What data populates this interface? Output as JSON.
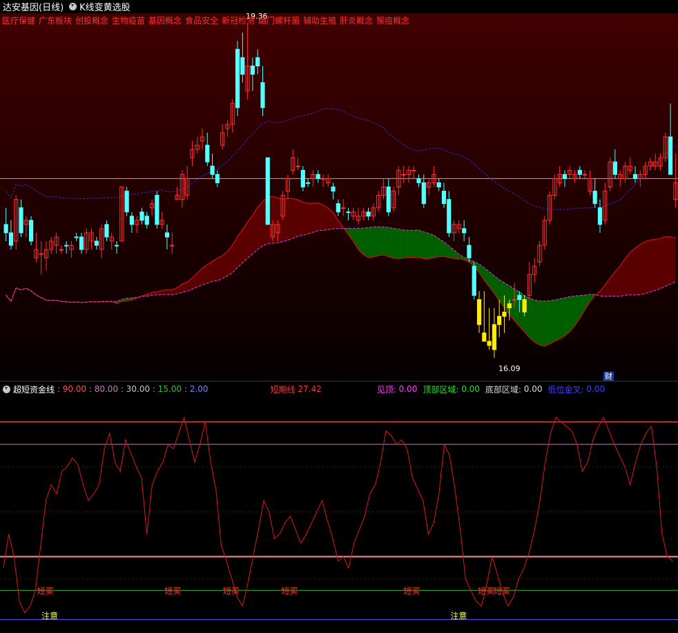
{
  "titlebar": {
    "stock_label": "达安基因(日线)",
    "formula_label": "K线变黄选股"
  },
  "tags": [
    "医疗保健",
    "广东板块",
    "创投概念",
    "生物疫苗",
    "基因概念",
    "食品安全",
    "新冠检测",
    "幽门螺杆菌",
    "辅助生殖",
    "肝炎概念",
    "猴痘概念"
  ],
  "price_labels": {
    "high": "19.36",
    "low": "16.09"
  },
  "cai_label": "财",
  "indicator": {
    "name": "超短资金线",
    "params": [
      {
        "value": "90.00",
        "color": "#ff5050"
      },
      {
        "value": "80.00",
        "color": "#c080c0"
      },
      {
        "value": "30.00",
        "color": "#c8c8c8"
      },
      {
        "value": "15.00",
        "color": "#30c030"
      },
      {
        "value": "2.00",
        "color": "#8080ff"
      }
    ],
    "short_label": "短期线",
    "short_value": "27.42",
    "top_label": "见顶:",
    "top_value": "0.00",
    "top_zone_label": "顶部区域:",
    "top_zone_value": "0.00",
    "bottom_zone_label": "底部区域:",
    "bottom_zone_value": "0.00",
    "low_cross_label": "低位金叉:",
    "low_cross_value": "0.00",
    "signal_buy": "短买",
    "signal_note": "注意"
  },
  "colors": {
    "up": "#ff3030",
    "down": "#54ffff",
    "yellow": "#ffee00",
    "bg_top": "#3a0000",
    "bg_bottom": "#000000"
  },
  "chart_data": {
    "type": "candlestick",
    "candles": [
      [
        16.9,
        17.1,
        16.7,
        16.8,
        "d"
      ],
      [
        16.8,
        16.95,
        16.6,
        16.65,
        "d"
      ],
      [
        16.7,
        17.25,
        16.6,
        17.2,
        "u"
      ],
      [
        17.1,
        17.2,
        16.75,
        16.8,
        "d"
      ],
      [
        16.9,
        17.0,
        16.75,
        16.95,
        "u"
      ],
      [
        16.95,
        17.0,
        16.65,
        16.7,
        "d"
      ],
      [
        16.6,
        16.8,
        16.45,
        16.5,
        "u"
      ],
      [
        16.55,
        16.7,
        16.3,
        16.55,
        "u"
      ],
      [
        16.6,
        16.7,
        16.35,
        16.5,
        "u"
      ],
      [
        16.6,
        16.75,
        16.55,
        16.7,
        "u"
      ],
      [
        16.65,
        16.8,
        16.55,
        16.75,
        "u"
      ],
      [
        16.6,
        16.65,
        16.55,
        16.6,
        "u"
      ],
      [
        16.65,
        16.7,
        16.55,
        16.65,
        "d"
      ],
      [
        16.6,
        16.7,
        16.5,
        16.65,
        "u"
      ],
      [
        16.75,
        16.8,
        16.7,
        16.75,
        "d"
      ],
      [
        16.75,
        16.8,
        16.55,
        16.6,
        "d"
      ],
      [
        16.6,
        16.85,
        16.55,
        16.8,
        "u"
      ],
      [
        16.7,
        16.85,
        16.6,
        16.8,
        "u"
      ],
      [
        16.7,
        16.75,
        16.6,
        16.65,
        "d"
      ],
      [
        16.6,
        16.9,
        16.5,
        16.85,
        "u"
      ],
      [
        16.9,
        16.95,
        16.7,
        16.75,
        "d"
      ],
      [
        16.7,
        16.8,
        16.6,
        16.75,
        "u"
      ],
      [
        16.65,
        16.7,
        16.55,
        16.65,
        "d"
      ],
      [
        16.7,
        17.35,
        16.7,
        17.35,
        "u"
      ],
      [
        17.3,
        17.35,
        17.0,
        17.05,
        "d"
      ],
      [
        17.0,
        17.05,
        16.8,
        16.9,
        "d"
      ],
      [
        16.9,
        17.0,
        16.8,
        16.95,
        "u"
      ],
      [
        16.95,
        17.1,
        16.9,
        17.05,
        "d"
      ],
      [
        17.0,
        17.05,
        16.85,
        16.9,
        "d"
      ],
      [
        17.1,
        17.2,
        17.0,
        17.15,
        "u"
      ],
      [
        17.25,
        17.3,
        16.85,
        16.9,
        "d"
      ],
      [
        16.9,
        17.05,
        16.85,
        16.95,
        "u"
      ],
      [
        16.75,
        16.9,
        16.6,
        16.8,
        "d"
      ],
      [
        16.65,
        16.8,
        16.55,
        16.65,
        "u"
      ],
      [
        17.2,
        17.35,
        17.2,
        17.25,
        "u"
      ],
      [
        17.2,
        17.55,
        17.1,
        17.5,
        "u"
      ],
      [
        17.45,
        17.6,
        17.2,
        17.25,
        "u"
      ],
      [
        17.7,
        17.9,
        17.6,
        17.8,
        "u"
      ],
      [
        17.8,
        17.95,
        17.75,
        17.85,
        "u"
      ],
      [
        17.9,
        18.05,
        17.8,
        17.95,
        "u"
      ],
      [
        17.85,
        18.0,
        17.6,
        17.65,
        "d"
      ],
      [
        17.6,
        17.75,
        17.45,
        17.5,
        "d"
      ],
      [
        17.5,
        17.55,
        17.35,
        17.4,
        "d"
      ],
      [
        17.85,
        18.1,
        17.8,
        18.0,
        "u"
      ],
      [
        18.05,
        18.15,
        17.95,
        18.1,
        "u"
      ],
      [
        18.1,
        18.4,
        18.0,
        18.35,
        "u"
      ],
      [
        18.3,
        19.1,
        18.2,
        19.0,
        "d"
      ],
      [
        18.9,
        19.2,
        18.6,
        18.7,
        "d"
      ],
      [
        18.5,
        19.3,
        18.4,
        18.8,
        "u"
      ],
      [
        18.8,
        18.9,
        18.5,
        18.7,
        "d"
      ],
      [
        18.8,
        19.0,
        18.7,
        18.9,
        "d"
      ],
      [
        18.6,
        18.8,
        18.2,
        18.3,
        "d"
      ],
      [
        16.9,
        17.7,
        16.9,
        17.7,
        "d"
      ],
      [
        16.75,
        16.95,
        16.7,
        16.9,
        "u"
      ],
      [
        16.8,
        16.95,
        16.7,
        16.9,
        "u"
      ],
      [
        17.0,
        17.3,
        16.95,
        17.25,
        "u"
      ],
      [
        17.3,
        17.5,
        17.2,
        17.45,
        "u"
      ],
      [
        17.55,
        17.8,
        17.5,
        17.7,
        "u"
      ],
      [
        17.6,
        17.7,
        17.55,
        17.6,
        "u"
      ],
      [
        17.55,
        17.6,
        17.3,
        17.35,
        "d"
      ],
      [
        17.4,
        17.45,
        17.35,
        17.4,
        "d"
      ],
      [
        17.45,
        17.55,
        17.35,
        17.5,
        "u"
      ],
      [
        17.45,
        17.55,
        17.4,
        17.5,
        "d"
      ],
      [
        17.45,
        17.5,
        17.35,
        17.45,
        "u"
      ],
      [
        17.45,
        17.5,
        17.35,
        17.4,
        "u"
      ],
      [
        17.35,
        17.4,
        17.2,
        17.3,
        "d"
      ],
      [
        17.15,
        17.2,
        17.0,
        17.05,
        "d"
      ],
      [
        17.1,
        17.2,
        17.0,
        17.1,
        "u"
      ],
      [
        17.05,
        17.1,
        16.95,
        17.05,
        "d"
      ],
      [
        17.0,
        17.1,
        16.95,
        17.05,
        "u"
      ],
      [
        17.0,
        17.1,
        16.9,
        16.95,
        "u"
      ],
      [
        17.0,
        17.1,
        16.95,
        17.05,
        "u"
      ],
      [
        17.05,
        17.1,
        16.95,
        17.0,
        "d"
      ],
      [
        17.0,
        17.15,
        16.95,
        17.1,
        "u"
      ],
      [
        17.1,
        17.3,
        17.05,
        17.25,
        "u"
      ],
      [
        17.25,
        17.45,
        17.2,
        17.35,
        "u"
      ],
      [
        17.35,
        17.45,
        17.0,
        17.05,
        "d"
      ],
      [
        17.1,
        17.35,
        17.05,
        17.3,
        "u"
      ],
      [
        17.35,
        17.6,
        17.25,
        17.55,
        "u"
      ],
      [
        17.5,
        17.6,
        17.4,
        17.5,
        "u"
      ],
      [
        17.55,
        17.6,
        17.4,
        17.5,
        "u"
      ],
      [
        17.55,
        17.6,
        17.45,
        17.55,
        "u"
      ],
      [
        17.4,
        17.5,
        17.35,
        17.45,
        "d"
      ],
      [
        17.4,
        17.5,
        17.1,
        17.15,
        "d"
      ],
      [
        17.35,
        17.45,
        17.25,
        17.4,
        "u"
      ],
      [
        17.4,
        17.6,
        17.35,
        17.5,
        "u"
      ],
      [
        17.4,
        17.45,
        17.3,
        17.35,
        "d"
      ],
      [
        17.3,
        17.4,
        17.1,
        17.15,
        "d"
      ],
      [
        17.2,
        17.3,
        16.75,
        16.8,
        "d"
      ],
      [
        16.9,
        16.95,
        16.7,
        16.8,
        "u"
      ],
      [
        16.85,
        16.95,
        16.8,
        16.9,
        "u"
      ],
      [
        16.85,
        16.95,
        16.7,
        16.8,
        "d"
      ],
      [
        16.65,
        16.75,
        16.45,
        16.5,
        "d"
      ],
      [
        16.4,
        16.45,
        16.0,
        16.05,
        "d"
      ],
      [
        16.0,
        16.1,
        15.6,
        15.7,
        "y"
      ],
      [
        15.6,
        16.1,
        15.5,
        15.5,
        "y"
      ],
      [
        15.45,
        15.9,
        15.4,
        15.5,
        "y"
      ],
      [
        15.4,
        15.9,
        15.3,
        15.7,
        "y"
      ],
      [
        15.7,
        16.0,
        15.55,
        15.8,
        "y"
      ],
      [
        15.8,
        16.05,
        15.6,
        15.85,
        "y"
      ],
      [
        15.9,
        16.0,
        15.75,
        15.95,
        "y"
      ],
      [
        16.0,
        16.2,
        15.9,
        16.0,
        "u"
      ],
      [
        16.0,
        16.1,
        15.85,
        16.05,
        "d"
      ],
      [
        16.0,
        16.05,
        15.8,
        15.85,
        "y"
      ],
      [
        16.3,
        16.45,
        16.0,
        16.05,
        "u"
      ],
      [
        16.3,
        16.5,
        16.2,
        16.4,
        "u"
      ],
      [
        16.45,
        16.7,
        16.4,
        16.65,
        "u"
      ],
      [
        16.65,
        17.0,
        16.6,
        16.95,
        "u"
      ],
      [
        16.95,
        17.3,
        16.9,
        17.25,
        "u"
      ],
      [
        17.25,
        17.5,
        17.2,
        17.45,
        "u"
      ],
      [
        17.4,
        17.6,
        17.35,
        17.5,
        "u"
      ],
      [
        17.45,
        17.55,
        17.35,
        17.5,
        "d"
      ],
      [
        17.5,
        17.6,
        17.45,
        17.55,
        "u"
      ],
      [
        17.5,
        17.55,
        17.4,
        17.45,
        "u"
      ],
      [
        17.55,
        17.6,
        17.45,
        17.5,
        "d"
      ],
      [
        17.5,
        17.55,
        17.45,
        17.5,
        "u"
      ],
      [
        17.3,
        17.55,
        17.25,
        17.45,
        "u"
      ],
      [
        17.3,
        17.45,
        17.1,
        17.15,
        "d"
      ],
      [
        17.1,
        17.2,
        16.8,
        16.9,
        "d"
      ],
      [
        16.95,
        17.4,
        16.9,
        17.3,
        "u"
      ],
      [
        17.35,
        17.7,
        17.3,
        17.65,
        "u"
      ],
      [
        17.65,
        17.8,
        17.45,
        17.5,
        "d"
      ],
      [
        17.5,
        17.55,
        17.35,
        17.45,
        "u"
      ],
      [
        17.45,
        17.65,
        17.4,
        17.6,
        "u"
      ],
      [
        17.6,
        17.7,
        17.5,
        17.55,
        "u"
      ],
      [
        17.5,
        17.6,
        17.4,
        17.45,
        "d"
      ],
      [
        17.45,
        17.55,
        17.35,
        17.5,
        "u"
      ],
      [
        17.5,
        17.65,
        17.45,
        17.6,
        "u"
      ],
      [
        17.6,
        17.7,
        17.55,
        17.65,
        "u"
      ],
      [
        17.65,
        17.75,
        17.55,
        17.6,
        "u"
      ],
      [
        17.6,
        17.75,
        17.55,
        17.7,
        "u"
      ],
      [
        17.7,
        18.0,
        17.65,
        17.95,
        "u"
      ],
      [
        17.95,
        18.35,
        17.5,
        17.5,
        "d"
      ],
      [
        17.4,
        17.75,
        17.1,
        17.2,
        "u"
      ]
    ],
    "oscillator": [
      25,
      40,
      30,
      10,
      5,
      8,
      15,
      35,
      55,
      62,
      58,
      68,
      70,
      74,
      71,
      62,
      55,
      58,
      62,
      78,
      85,
      72,
      68,
      82,
      76,
      70,
      65,
      40,
      62,
      68,
      72,
      80,
      78,
      85,
      92,
      82,
      72,
      80,
      90,
      72,
      60,
      35,
      28,
      20,
      12,
      8,
      18,
      30,
      42,
      55,
      50,
      38,
      40,
      45,
      48,
      42,
      36,
      40,
      45,
      50,
      55,
      46,
      38,
      28,
      30,
      25,
      36,
      42,
      48,
      58,
      62,
      72,
      86,
      84,
      80,
      82,
      78,
      65,
      60,
      55,
      40,
      45,
      58,
      80,
      75,
      60,
      42,
      20,
      15,
      10,
      8,
      18,
      30,
      22,
      14,
      8,
      12,
      20,
      25,
      32,
      42,
      55,
      72,
      85,
      92,
      90,
      88,
      86,
      80,
      68,
      72,
      82,
      88,
      92,
      86,
      80,
      75,
      70,
      62,
      72,
      80,
      85,
      88,
      70,
      40,
      30,
      28
    ]
  }
}
